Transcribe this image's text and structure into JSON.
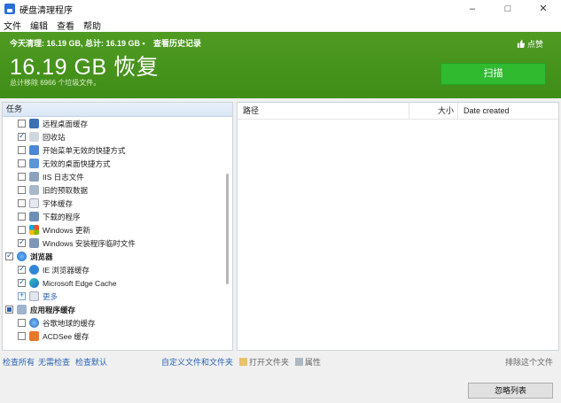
{
  "window": {
    "title": "硬盘清理程序",
    "minimize": "–",
    "maximize": "□",
    "close": "✕"
  },
  "menu": [
    "文件",
    "编辑",
    "查看",
    "帮助"
  ],
  "banner": {
    "today_summary": "今天清理: 16.19 GB, 总计: 16.19 GB •",
    "history_link": "查看历史记录",
    "big_text": "16.19 GB 恢复",
    "sub_text": "总计移除 6966 个垃圾文件。",
    "like": "点赞",
    "scan_button": "扫描",
    "accent": "#3f8d17",
    "scan_color": "#2fba2f"
  },
  "tasks": {
    "header": "任务",
    "items": [
      {
        "label": "远程桌面缓存",
        "checked": false,
        "icon": "remote-desktop-icon"
      },
      {
        "label": "回收站",
        "checked": true,
        "icon": "recycle-bin-icon"
      },
      {
        "label": "开始菜单无效的快捷方式",
        "checked": false,
        "icon": "start-menu-icon"
      },
      {
        "label": "无效的桌面快捷方式",
        "checked": false,
        "icon": "desktop-shortcut-icon"
      },
      {
        "label": "IIS 日志文件",
        "checked": false,
        "icon": "log-file-icon"
      },
      {
        "label": "旧的预取数据",
        "checked": false,
        "icon": "prefetch-icon"
      },
      {
        "label": "字体缓存",
        "checked": false,
        "icon": "font-icon"
      },
      {
        "label": "下载的程序",
        "checked": false,
        "icon": "downloaded-program-icon"
      },
      {
        "label": "Windows 更新",
        "checked": false,
        "icon": "windows-update-icon"
      },
      {
        "label": "Windows 安装程序临时文件",
        "checked": true,
        "icon": "installer-icon"
      }
    ],
    "browsers_group": "浏览器",
    "browser_items": [
      {
        "label": "IE 浏览器缓存",
        "checked": true,
        "icon": "ie-icon"
      },
      {
        "label": "Microsoft Edge Cache",
        "checked": true,
        "icon": "edge-icon"
      }
    ],
    "more": "更多",
    "app_cache_group": "应用程序缓存",
    "app_items": [
      {
        "label": "谷歌地球的缓存",
        "checked": false,
        "icon": "google-earth-icon"
      },
      {
        "label": "ACDSee 缓存",
        "checked": false,
        "icon": "acdsee-icon"
      }
    ]
  },
  "files": {
    "col_path": "路径",
    "col_size": "大小",
    "col_date": "Date created"
  },
  "bottom": {
    "check_all": "检查所有",
    "check_none": "无需检查",
    "check_default": "检查默认",
    "custom": "自定义文件和文件夹",
    "open_folder": "打开文件夹",
    "properties": "属性",
    "exclude": "排除这个文件",
    "ignore_list": "忽略列表"
  }
}
